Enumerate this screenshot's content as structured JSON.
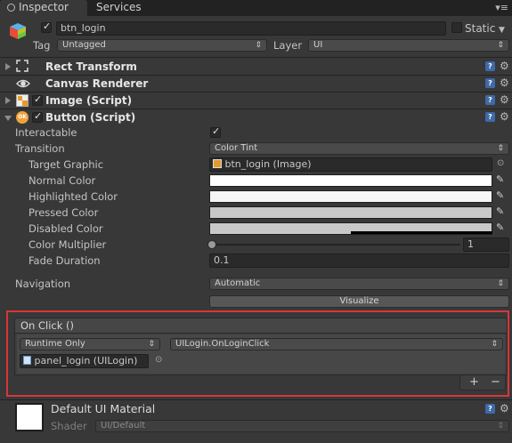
{
  "tabs": [
    {
      "label": "Inspector",
      "icon": "info-icon"
    },
    {
      "label": "Services"
    }
  ],
  "menu_icon": "menu-icon",
  "gameobject": {
    "active": true,
    "name": "btn_login",
    "static_label": "Static",
    "static_checked": false,
    "tag_label": "Tag",
    "tag_value": "Untagged",
    "layer_label": "Layer",
    "layer_value": "UI"
  },
  "components": [
    {
      "name": "Rect Transform",
      "icon": "rect-transform-icon",
      "has_checkbox": false
    },
    {
      "name": "Canvas Renderer",
      "icon": "eye-icon",
      "has_checkbox": false
    },
    {
      "name": "Image (Script)",
      "icon": "image-icon",
      "has_checkbox": true,
      "checked": true
    },
    {
      "name": "Button (Script)",
      "icon": "ok-button-icon",
      "has_checkbox": true,
      "checked": true
    }
  ],
  "button_script": {
    "interactable_label": "Interactable",
    "interactable": true,
    "transition_label": "Transition",
    "transition_value": "Color Tint",
    "target_graphic_label": "Target Graphic",
    "target_graphic_value": "btn_login (Image)",
    "normal_color_label": "Normal Color",
    "normal_color": "#ffffff",
    "highlighted_color_label": "Highlighted Color",
    "highlighted_color": "#f5f5f5",
    "pressed_color_label": "Pressed Color",
    "pressed_color": "#c8c8c8",
    "disabled_color_label": "Disabled Color",
    "disabled_color": "#c8c8c8",
    "color_multiplier_label": "Color Multiplier",
    "color_multiplier_value": "1",
    "color_multiplier_fraction": 0.0,
    "fade_duration_label": "Fade Duration",
    "fade_duration_value": "0.1",
    "navigation_label": "Navigation",
    "navigation_value": "Automatic",
    "visualize_label": "Visualize"
  },
  "onclick": {
    "header": "On Click ()",
    "runtime_value": "Runtime Only",
    "function_value": "UILogin.OnLoginClick",
    "object_value": "panel_login (UILogin)",
    "add_label": "+",
    "remove_label": "−"
  },
  "material": {
    "name": "Default UI Material",
    "shader_label": "Shader",
    "shader_value": "UI/Default"
  },
  "colors": {
    "highlight_border": "#d6373a",
    "help_icon": "#3e6aa8"
  }
}
